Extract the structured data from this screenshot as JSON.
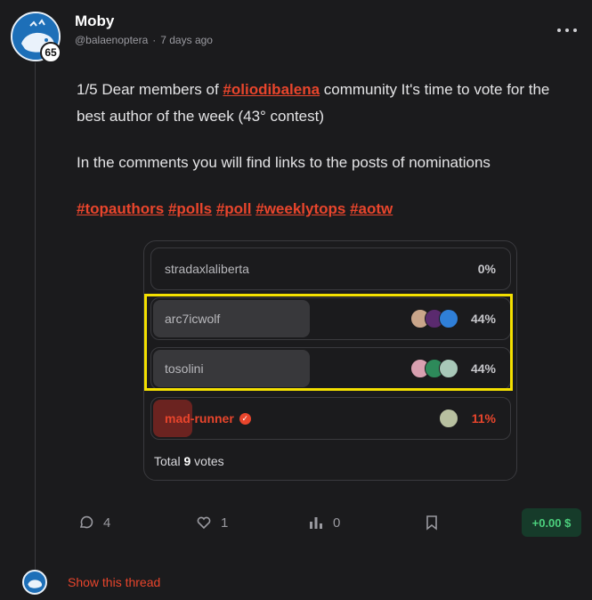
{
  "post": {
    "author": "Moby",
    "handle": "@balaenoptera",
    "separator": "·",
    "time": "7 days ago",
    "reputation": "65",
    "body": {
      "p1_prefix": "1/5 Dear members of ",
      "p1_tag": "#oliodibalena",
      "p1_suffix": " community It's time to vote for the best author of the week (43° contest)",
      "p2": "In the comments you will find links to the posts of nominations",
      "tags": [
        "#topauthors",
        "#polls",
        "#poll",
        "#weeklytops",
        "#aotw"
      ]
    }
  },
  "poll": {
    "options": [
      {
        "label": "stradaxlaliberta",
        "percent": "0%",
        "share": 0
      },
      {
        "label": "arc7icwolf",
        "percent": "44%",
        "share": 0.44
      },
      {
        "label": "tosolini",
        "percent": "44%",
        "share": 0.44
      },
      {
        "label": "mad-runner",
        "percent": "11%",
        "share": 0.11
      }
    ],
    "total_prefix": "Total",
    "total_count": "9",
    "total_suffix": "votes"
  },
  "actions": {
    "comments_count": "4",
    "likes_count": "1",
    "stats_count": "0",
    "payout": "+0.00 $"
  },
  "footer": {
    "show_thread": "Show this thread"
  },
  "colors": {
    "accent": "#e8452c",
    "highlight": "#f4e000",
    "payout_green": "#4cd07d"
  }
}
